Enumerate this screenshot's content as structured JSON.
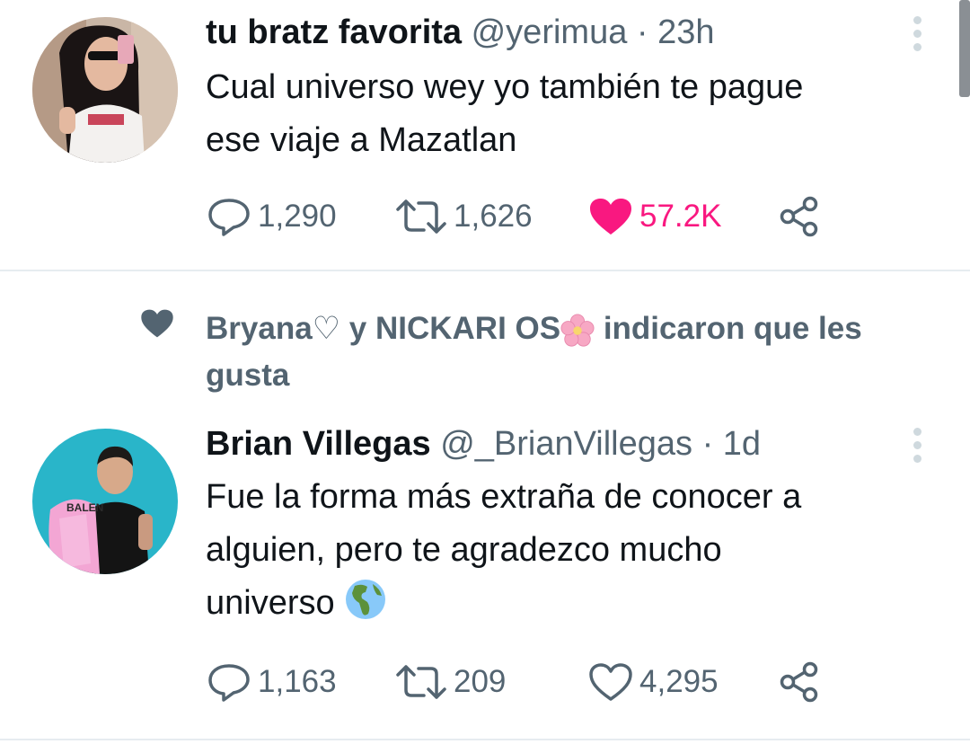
{
  "tweet1": {
    "name": "tu bratz favorita",
    "handle": "@yerimua",
    "separator": "·",
    "time": "23h",
    "text_lines": [
      "Cual universo wey yo también te pague",
      "ese viaje a Mazatlan"
    ],
    "replies": "1,290",
    "retweets": "1,626",
    "likes": "57.2K",
    "liked": true
  },
  "social_context": {
    "text_part1": "Bryana♡ y NICKARI OS",
    "emoji": "cherry-blossom",
    "text_part2": " indicaron que les",
    "text_line2": "gusta"
  },
  "tweet2": {
    "name": "Brian Villegas",
    "handle": "@_BrianVillegas",
    "separator": "·",
    "time": "1d",
    "text_lines": [
      "Fue la forma más extraña de conocer a",
      "alguien, pero te agradezco mucho",
      "universo"
    ],
    "emoji": "globe-americas",
    "avatar_shirt_text": "BALEN",
    "replies": "1,163",
    "retweets": "209",
    "likes": "4,295",
    "liked": false
  },
  "colors": {
    "text": "#0f1419",
    "secondary": "#536471",
    "like_pink": "#f91880",
    "divider": "#e6ecf0",
    "avatar2_bg": "#29b5c9"
  }
}
